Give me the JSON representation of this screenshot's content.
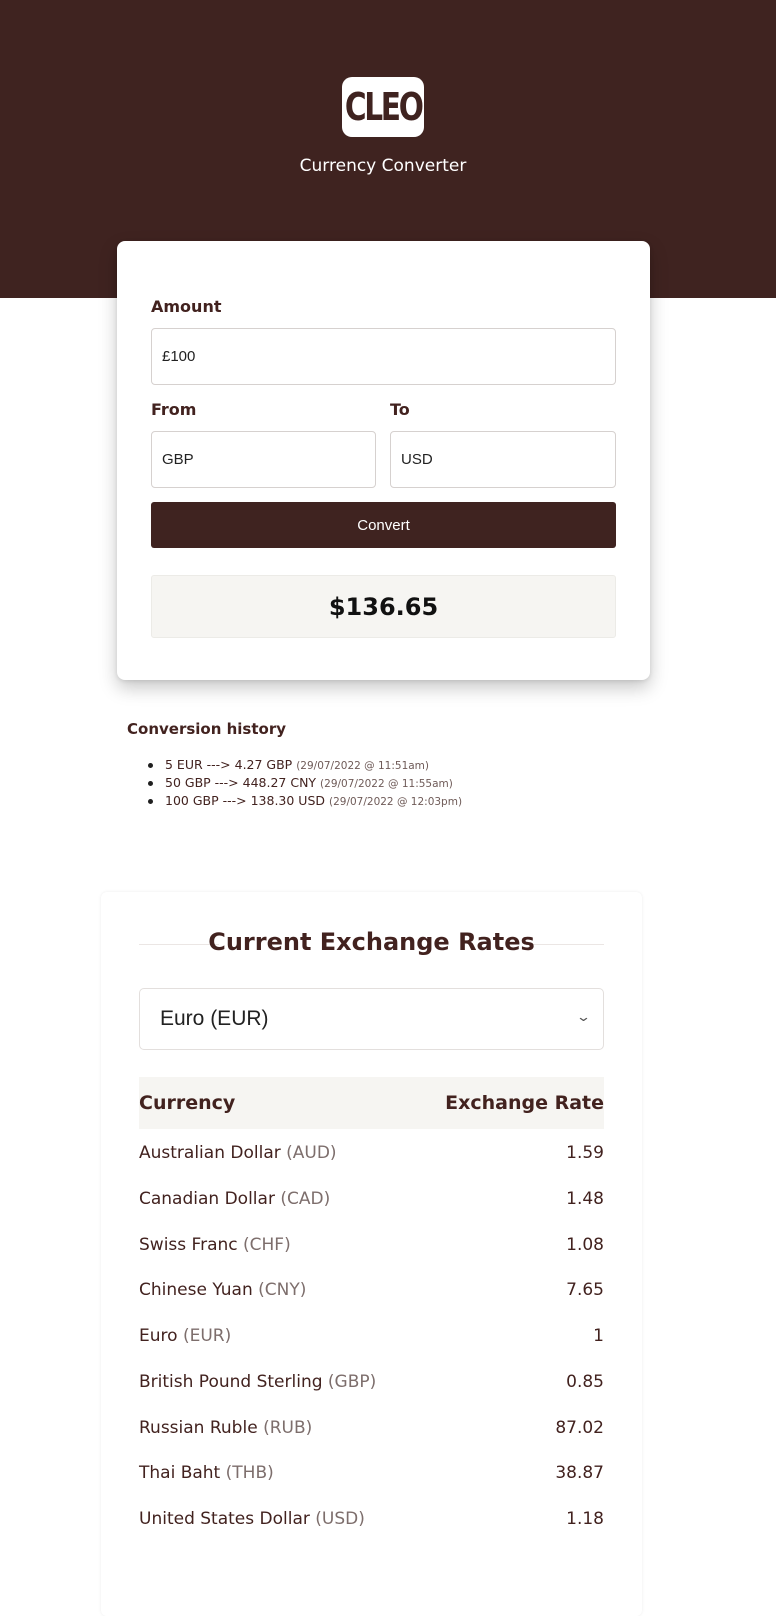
{
  "header": {
    "logo_text": "CLEO",
    "subtitle": "Currency Converter",
    "background_color": "#3f2320"
  },
  "converter": {
    "amount_label": "Amount",
    "amount_value": "£100",
    "from_label": "From",
    "from_value": "GBP",
    "to_label": "To",
    "to_value": "USD",
    "convert_label": "Convert",
    "result": "$136.65"
  },
  "history": {
    "title": "Conversion history",
    "items": [
      {
        "text": "5 EUR ---> 4.27 GBP",
        "timestamp": "(29/07/2022 @ 11:51am)"
      },
      {
        "text": "50 GBP ---> 448.27 CNY",
        "timestamp": "(29/07/2022 @ 11:55am)"
      },
      {
        "text": "100 GBP ---> 138.30 USD",
        "timestamp": "(29/07/2022 @ 12:03pm)"
      }
    ]
  },
  "rates": {
    "title": "Current Exchange Rates",
    "selected_currency": "Euro (EUR)",
    "columns": {
      "currency": "Currency",
      "rate": "Exchange Rate"
    },
    "rows": [
      {
        "name": "Australian Dollar",
        "code": "(AUD)",
        "rate": "1.59"
      },
      {
        "name": "Canadian Dollar",
        "code": "(CAD)",
        "rate": "1.48"
      },
      {
        "name": "Swiss Franc",
        "code": "(CHF)",
        "rate": "1.08"
      },
      {
        "name": "Chinese Yuan",
        "code": "(CNY)",
        "rate": "7.65"
      },
      {
        "name": "Euro",
        "code": "(EUR)",
        "rate": "1"
      },
      {
        "name": "British Pound Sterling",
        "code": "(GBP)",
        "rate": "0.85"
      },
      {
        "name": "Russian Ruble",
        "code": "(RUB)",
        "rate": "87.02"
      },
      {
        "name": "Thai Baht",
        "code": "(THB)",
        "rate": "38.87"
      },
      {
        "name": "United States Dollar",
        "code": "(USD)",
        "rate": "1.18"
      }
    ]
  }
}
